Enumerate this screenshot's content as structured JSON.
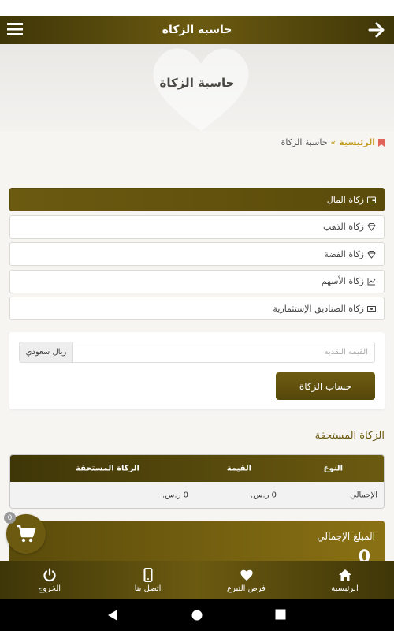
{
  "app_bar": {
    "title": "حاسبة الزكاة",
    "back_icon": "arrow-right-icon",
    "menu_icon": "hamburger-menu-icon"
  },
  "hero": {
    "title": "حاسبة الزكاة"
  },
  "breadcrumb": {
    "home": "الرئيسية",
    "separator": "»",
    "current": "حاسبة الزكاة"
  },
  "tabs": [
    {
      "label": "زكاة المال",
      "icon": "wallet-icon",
      "active": true
    },
    {
      "label": "زكاة الذهب",
      "icon": "diamond-icon",
      "active": false
    },
    {
      "label": "زكاة الفضة",
      "icon": "diamond-icon",
      "active": false
    },
    {
      "label": "زكاة الأسهم",
      "icon": "chart-icon",
      "active": false
    },
    {
      "label": "زكاة الصناديق الإستثمارية",
      "icon": "money-icon",
      "active": false
    }
  ],
  "calculator": {
    "amount_placeholder": "القيمه النقديه",
    "amount_value": "",
    "currency": "ريال سعودي",
    "submit_label": "حساب الزكاة"
  },
  "results": {
    "section_title": "الزكاة المستحقة",
    "columns": [
      "النوع",
      "القيمة",
      "الزكاة المستحقة"
    ],
    "rows": [
      {
        "type": "الإجمالي",
        "value": "0 ر.س.",
        "zakat": "0 ر.س."
      }
    ]
  },
  "total": {
    "label": "المبلغ الإجمالي",
    "value": "0"
  },
  "cart": {
    "count": "0"
  },
  "bottom_nav": [
    {
      "label": "الرئيسية",
      "icon": "home-icon"
    },
    {
      "label": "فرص التبرع",
      "icon": "heart-icon"
    },
    {
      "label": "اتصل بنا",
      "icon": "phone-icon"
    },
    {
      "label": "الخروج",
      "icon": "power-icon"
    }
  ],
  "colors": {
    "primary": "#6b5a10",
    "primary_dark": "#3f3608",
    "accent": "#c39b1e",
    "background": "#f6f5f2"
  }
}
